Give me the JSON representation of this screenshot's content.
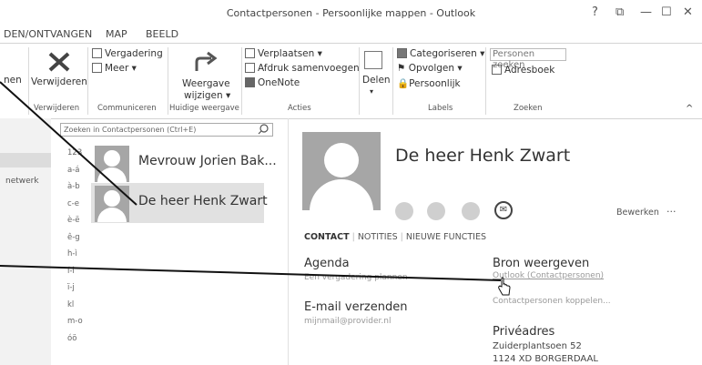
{
  "window": {
    "title": "Contactpersonen - Persoonlijke mappen - Outlook",
    "controls": [
      "?",
      "⧉",
      "—",
      "☐",
      "✕"
    ]
  },
  "tabs": [
    "DEN/ONTVANGEN",
    "MAP",
    "BEELD"
  ],
  "ribbon": {
    "partial_label": "nen",
    "delete": {
      "label": "Verwijderen",
      "group": "Verwijderen"
    },
    "communicate": {
      "meeting": "Vergadering",
      "more": "Meer ▾",
      "group": "Communiceren"
    },
    "view": {
      "label1": "Weergave",
      "label2": "wijzigen ▾",
      "group": "Huidige weergave"
    },
    "actions": {
      "move": "Verplaatsen ▾",
      "mailmerge": "Afdruk samenvoegen",
      "onenote": "OneNote",
      "group": "Acties"
    },
    "share": {
      "label": "Delen",
      "arrow": "▾"
    },
    "tags": {
      "categorize": "Categoriseren ▾",
      "followup": "Opvolgen ▾",
      "private": "Persoonlijk",
      "group": "Labels"
    },
    "find": {
      "search_placeholder": "Personen zoeken",
      "addressbook": "Adresboek",
      "group": "Zoeken"
    },
    "collapse": "^"
  },
  "nav": {
    "item": "netwerk"
  },
  "search": {
    "placeholder": "Zoeken in Contactpersonen (Ctrl+E)"
  },
  "letters": [
    "123",
    "a-á",
    "à-b",
    "c-e",
    "è-ë",
    "ê-g",
    "h-ì",
    "í-î",
    "ï-j",
    "kl",
    "m-o",
    "óö"
  ],
  "contacts": [
    {
      "name": "Mevrouw Jorien Bak..."
    },
    {
      "name": "De heer Henk Zwart"
    }
  ],
  "detail": {
    "name": "De heer Henk Zwart",
    "edit": "Bewerken",
    "more": "···",
    "tabs": [
      "CONTACT",
      "NOTITIES",
      "NIEUWE FUNCTIES"
    ],
    "agenda": {
      "title": "Agenda",
      "sub": "Een vergadering plannen"
    },
    "email": {
      "title": "E-mail verzenden",
      "sub": "mijnmail@provider.nl"
    },
    "source": {
      "title": "Bron weergeven",
      "link": "Outlook (Contactpersonen)",
      "link2": "Contactpersonen koppelen..."
    },
    "address": {
      "title": "Privéadres",
      "line1": "Zuiderplantsoen 52",
      "line2": "1124 XD BORGERDAAL"
    }
  }
}
